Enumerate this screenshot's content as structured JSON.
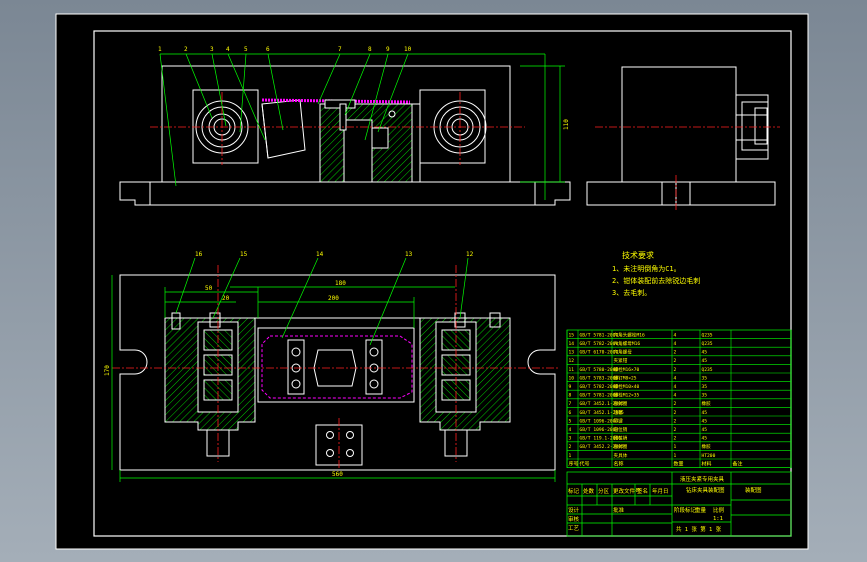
{
  "colors": {
    "background": "#000000",
    "frame": "#ffffff",
    "outline": "#ffffff",
    "leader": "#00ff00",
    "center_line": "#ff2020",
    "hatch": "#00ff00",
    "dimension": "#00ff00",
    "text": "#ffff00",
    "magenta": "#ff00ff",
    "table_line": "#00ff00",
    "viewport": "#8a96a4"
  },
  "technical_requirements": {
    "title": "技术要求",
    "items": [
      "1、未注明倒角为C1。",
      "2、钳体装配前去除锐边毛刺",
      "3、去毛刺。"
    ]
  },
  "front_view_callouts": [
    "1",
    "2",
    "3",
    "4",
    "5",
    "6",
    "7",
    "8",
    "9",
    "10"
  ],
  "top_view_callouts": [
    "16",
    "15",
    "14",
    "13",
    "12"
  ],
  "dimensions": {
    "front_height": "110",
    "top_width": "560",
    "top_depth": "170",
    "inner_span": "200",
    "left_offset": "50",
    "slot": "20",
    "center_span": "180"
  },
  "bom": {
    "rows": [
      {
        "no": "15",
        "std": "GB/T 5781-2000",
        "name": "六角头螺栓M16",
        "qty": "4",
        "mat": "Q235"
      },
      {
        "no": "14",
        "std": "GB/T 5782-2000",
        "name": "六角螺母M16",
        "qty": "4",
        "mat": "Q235"
      },
      {
        "no": "13",
        "std": "GB/T 6170-2000",
        "name": "六角螺母",
        "qty": "2",
        "mat": "45"
      },
      {
        "no": "12",
        "std": "",
        "name": "夹紧钳",
        "qty": "2",
        "mat": "45"
      },
      {
        "no": "11",
        "std": "GB/T 5780-2000",
        "name": "螺栓M16×70",
        "qty": "2",
        "mat": "Q235"
      },
      {
        "no": "10",
        "std": "GB/T 5783-2000",
        "name": "螺钉M8×25",
        "qty": "4",
        "mat": "35"
      },
      {
        "no": "9",
        "std": "GB/T 5782-2000",
        "name": "螺栓M10×40",
        "qty": "4",
        "mat": "35"
      },
      {
        "no": "8",
        "std": "GB/T 5781-2000",
        "name": "螺栓M12×35",
        "qty": "4",
        "mat": "35"
      },
      {
        "no": "7",
        "std": "GB/T 3452.1-2005",
        "name": "密封圈",
        "qty": "2",
        "mat": "橡胶"
      },
      {
        "no": "6",
        "std": "GB/T 3452.1-2005",
        "name": "活塞",
        "qty": "2",
        "mat": "45"
      },
      {
        "no": "5",
        "std": "GB/T 1096-2003",
        "name": "平键",
        "qty": "2",
        "mat": "45"
      },
      {
        "no": "4",
        "std": "GB/T 1096-2003",
        "name": "定位销",
        "qty": "2",
        "mat": "45"
      },
      {
        "no": "3",
        "std": "GB/T 119.1-2000",
        "name": "圆柱销",
        "qty": "2",
        "mat": "45"
      },
      {
        "no": "2",
        "std": "GB/T 3452.2-2005",
        "name": "密封圈",
        "qty": "1",
        "mat": "橡胶"
      },
      {
        "no": "1",
        "std": "",
        "name": "夹具体",
        "qty": "1",
        "mat": "HT200"
      }
    ],
    "header": {
      "no": "序号",
      "std": "代号",
      "name": "名称",
      "qty": "数量",
      "mat": "材料",
      "note": "备注"
    }
  },
  "title_block": {
    "drawing_title": "液压夹紧专用夹具",
    "subtitle": "钻床夹具装配图",
    "drawing_no": "装配图",
    "labels": [
      "标记",
      "处数",
      "分区",
      "更改文件号",
      "签名",
      "年月日",
      "设计",
      "审核",
      "工艺",
      "批准",
      "阶段标记",
      "重量",
      "比例"
    ],
    "scale": "1:1",
    "sheet": "共 1 张 第 1 张"
  }
}
